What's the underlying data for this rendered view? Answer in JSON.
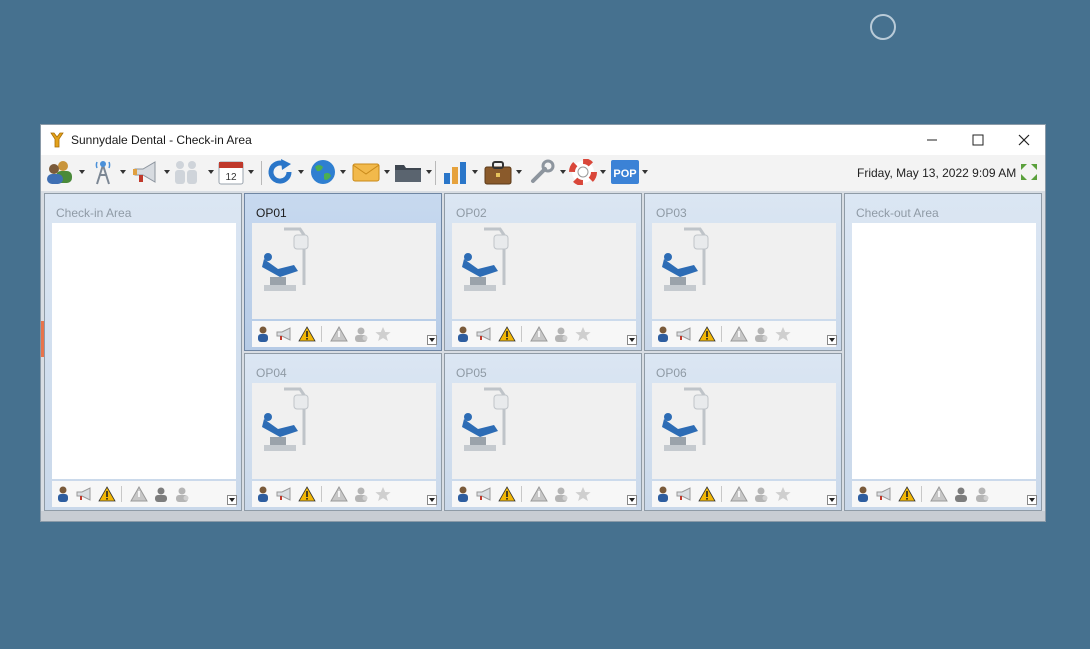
{
  "window": {
    "title": "Sunnydale Dental - Check-in Area",
    "controls": [
      "minimize-icon",
      "maximize-icon",
      "close-icon"
    ]
  },
  "toolbar": {
    "buttons": [
      {
        "name": "patients-button",
        "icon": "patients-icon"
      },
      {
        "name": "network-button",
        "icon": "antenna-icon"
      },
      {
        "name": "announce-button",
        "icon": "megaphone-icon"
      },
      {
        "name": "staff-button",
        "icon": "people-icon"
      },
      {
        "name": "calendar-button",
        "icon": "calendar-icon",
        "label": "12"
      },
      {
        "name": "refresh-button",
        "icon": "refresh-icon"
      },
      {
        "name": "web-button",
        "icon": "globe-icon"
      },
      {
        "name": "mail-button",
        "icon": "envelope-icon"
      },
      {
        "name": "folder-button",
        "icon": "folder-icon"
      },
      {
        "name": "reports-button",
        "icon": "bar-chart-icon"
      },
      {
        "name": "tools-button",
        "icon": "briefcase-icon"
      },
      {
        "name": "settings-button",
        "icon": "wrench-icon"
      },
      {
        "name": "help-button",
        "icon": "lifebuoy-icon"
      },
      {
        "name": "pop-button",
        "icon": "pop-icon",
        "label": "POP"
      }
    ],
    "datetime": "Friday, May 13, 2022 9:09 AM"
  },
  "panels": {
    "checkin": {
      "label": "Check-in Area"
    },
    "checkout": {
      "label": "Check-out Area"
    },
    "ops": [
      {
        "label": "OP01",
        "selected": true
      },
      {
        "label": "OP02",
        "selected": false
      },
      {
        "label": "OP03",
        "selected": false
      },
      {
        "label": "OP04",
        "selected": false
      },
      {
        "label": "OP05",
        "selected": false
      },
      {
        "label": "OP06",
        "selected": false
      }
    ]
  },
  "status_icons": {
    "operatory": [
      "patient-icon",
      "megaphone-icon",
      "warning-icon",
      "warning-gray-icon",
      "person-gray-icon",
      "star-icon"
    ],
    "area": [
      "patient-icon",
      "megaphone-icon",
      "warning-icon",
      "warning-gray-icon",
      "person-icon",
      "person-gray-icon"
    ]
  },
  "colors": {
    "desktop": "#46718f",
    "panel_header": "#c9d8ea",
    "pop_button": "#3b82d6",
    "warning": "#f2b705"
  }
}
